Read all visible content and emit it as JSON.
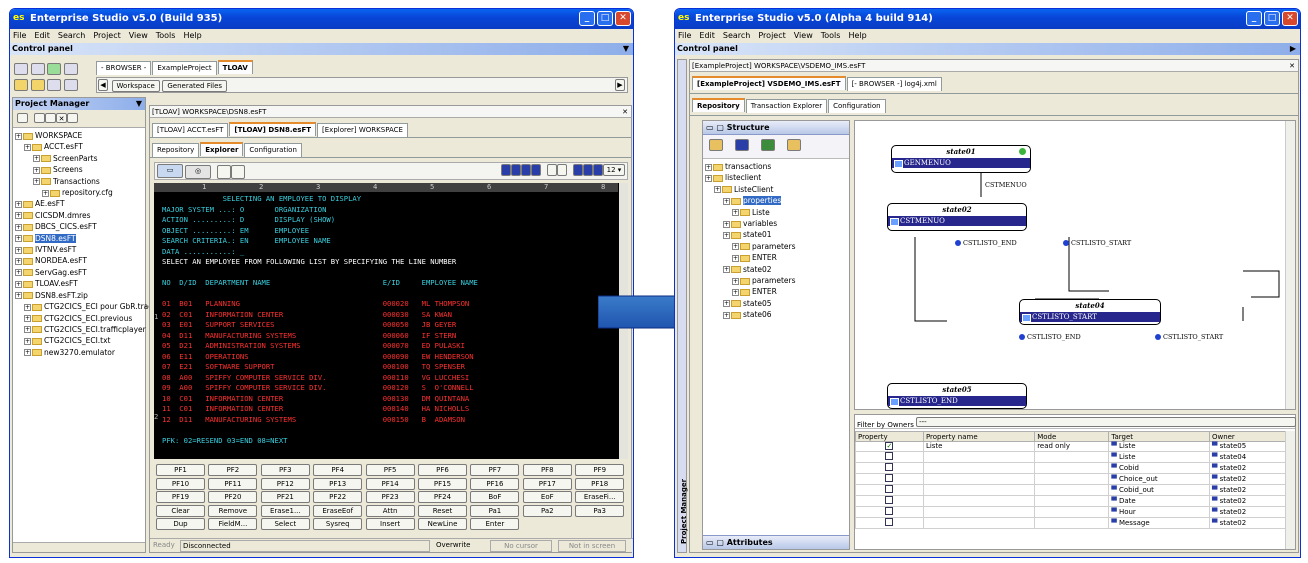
{
  "left": {
    "title": "Enterprise Studio v5.0 (Build 935)",
    "menu": [
      "File",
      "Edit",
      "Search",
      "Project",
      "View",
      "Tools",
      "Help"
    ],
    "control_panel": "Control panel",
    "browser_tabs": [
      "- BROWSER -",
      "ExampleProject",
      "TLOAV"
    ],
    "workspace_btn": "Workspace",
    "generated_btn": "Generated Files",
    "project_manager": "Project Manager",
    "tree": [
      {
        "t": "WORKSPACE",
        "l": 0
      },
      {
        "t": "ACCT.esFT",
        "l": 1
      },
      {
        "t": "ScreenParts",
        "l": 2
      },
      {
        "t": "Screens",
        "l": 2
      },
      {
        "t": "Transactions",
        "l": 2
      },
      {
        "t": "repository.cfg",
        "l": 3
      },
      {
        "t": "AE.esFT",
        "l": 0
      },
      {
        "t": "CICSDM.dmres",
        "l": 0
      },
      {
        "t": "DBCS_CICS.esFT",
        "l": 0
      },
      {
        "t": "DSN8.esFT",
        "l": 0,
        "sel": true
      },
      {
        "t": "IVTNV.esFT",
        "l": 0
      },
      {
        "t": "NORDEA.esFT",
        "l": 0
      },
      {
        "t": "ServGag.esFT",
        "l": 0
      },
      {
        "t": "TLOAV.esFT",
        "l": 0
      },
      {
        "t": "DSN8.esFT.zip",
        "l": 0
      },
      {
        "t": "CTG2CICS_ECI pour GbR.trace",
        "l": 1
      },
      {
        "t": "CTG2CICS_ECI.previous",
        "l": 1
      },
      {
        "t": "CTG2CICS_ECI.trafficplayer",
        "l": 1
      },
      {
        "t": "CTG2CICS_ECI.txt",
        "l": 1
      },
      {
        "t": "new3270.emulator",
        "l": 1
      }
    ],
    "doc_path": "[TLOAV] WORKSPACE\\DSN8.esFT",
    "doc_tabs": [
      "[TLOAV] ACCT.esFT",
      "[TLOAV] DSN8.esFT",
      "[Explorer] WORKSPACE"
    ],
    "view_tabs": [
      "Repository",
      "Explorer",
      "Configuration"
    ],
    "font_size": "12",
    "ruler": [
      "1",
      "2",
      "3",
      "4",
      "5",
      "6",
      "7",
      "8"
    ],
    "screen_lines": [
      {
        "t": "              SELECTING AN EMPLOYEE TO DISPLAY",
        "c": "cyan"
      },
      {
        "t": "MAJOR SYSTEM ...: O       ORGANIZATION",
        "c": "cyan"
      },
      {
        "t": "ACTION .........: D       DISPLAY (SHOW)",
        "c": "cyan"
      },
      {
        "t": "OBJECT .........: EM      EMPLOYEE",
        "c": "cyan"
      },
      {
        "t": "SEARCH CRITERIA.: EN      EMPLOYEE NAME",
        "c": "cyan"
      },
      {
        "t": "DATA ...........: _",
        "c": "cyan"
      },
      {
        "t": "SELECT AN EMPLOYEE FROM FOLLOWING LIST BY SPECIFYING THE LINE NUMBER",
        "c": "wh"
      },
      {
        "t": "",
        "c": "wh"
      },
      {
        "t": "NO  D/ID  DEPARTMENT NAME                          E/ID     EMPLOYEE NAME",
        "c": "cyan"
      },
      {
        "t": "",
        "c": "wh"
      },
      {
        "t": "01  B01   PLANNING                                 000020   ML THOMPSON",
        "c": "red"
      },
      {
        "t": "02  C01   INFORMATION CENTER                       000030   SA KWAN",
        "c": "red"
      },
      {
        "t": "03  E01   SUPPORT SERVICES                         000050   JB GEYER",
        "c": "red"
      },
      {
        "t": "04  D11   MANUFACTURING SYSTEMS                    000060   IF STERN",
        "c": "red"
      },
      {
        "t": "05  D21   ADMINISTRATION SYSTEMS                   000070   ED PULASKI",
        "c": "red"
      },
      {
        "t": "06  E11   OPERATIONS                               000090   EW HENDERSON",
        "c": "red"
      },
      {
        "t": "07  E21   SOFTWARE SUPPORT                         000100   TQ SPENSER",
        "c": "red"
      },
      {
        "t": "08  A00   SPIFFY COMPUTER SERVICE DIV.             000110   VG LUCCHESI",
        "c": "red"
      },
      {
        "t": "09  A00   SPIFFY COMPUTER SERVICE DIV.             000120   S  O'CONNELL",
        "c": "red"
      },
      {
        "t": "10  C01   INFORMATION CENTER                       000130   DM QUINTANA",
        "c": "red"
      },
      {
        "t": "11  C01   INFORMATION CENTER                       000140   HA NICHOLLS",
        "c": "red"
      },
      {
        "t": "12  D11   MANUFACTURING SYSTEMS                    000150   B  ADAMSON",
        "c": "red"
      },
      {
        "t": "",
        "c": "wh"
      },
      {
        "t": "PFK: 02=RESEND 03=END 08=NEXT",
        "c": "cyan"
      }
    ],
    "keys": [
      [
        "PF1",
        "PF2",
        "PF3",
        "PF4",
        "PF5",
        "PF6",
        "PF7",
        "PF8",
        "PF9"
      ],
      [
        "PF10",
        "PF11",
        "PF12",
        "PF13",
        "PF14",
        "PF15",
        "PF16",
        "PF17",
        "PF18"
      ],
      [
        "PF19",
        "PF20",
        "PF21",
        "PF22",
        "PF23",
        "PF24",
        "BoF",
        "EoF",
        "EraseFi..."
      ],
      [
        "Clear",
        "Remove",
        "Erase1...",
        "EraseEof",
        "Attn",
        "Reset",
        "Pa1",
        "Pa2",
        "Pa3"
      ],
      [
        "Dup",
        "FieldM...",
        "Select",
        "Sysreq",
        "Insert",
        "NewLine",
        "Enter"
      ]
    ],
    "status": {
      "ready": "Ready",
      "conn": "Disconnected",
      "mode": "Overwrite",
      "cursor": "No cursor",
      "screen": "Not in screen"
    }
  },
  "right": {
    "title": "Enterprise Studio v5.0 (Alpha 4 build 914)",
    "menu": [
      "File",
      "Edit",
      "Search",
      "Project",
      "View",
      "Tools",
      "Help"
    ],
    "control_panel": "Control panel",
    "doc_path": "[ExampleProject]  WORKSPACE\\VSDEMO_IMS.esFT",
    "doc_tabs": [
      "[ExampleProject] VSDEMO_IMS.esFT",
      "[- BROWSER -] log4j.xml"
    ],
    "view_tabs": [
      "Repository",
      "Transaction Explorer",
      "Configuration"
    ],
    "structure": "Structure",
    "attributes": "Attributes",
    "side_label": "Project Manager",
    "tree": [
      {
        "t": "transactions",
        "l": 0
      },
      {
        "t": "listeclient",
        "l": 0
      },
      {
        "t": "ListeClient",
        "l": 1
      },
      {
        "t": "properties",
        "l": 2,
        "sel": true
      },
      {
        "t": "Liste",
        "l": 3
      },
      {
        "t": "variables",
        "l": 2
      },
      {
        "t": "state01",
        "l": 2
      },
      {
        "t": "parameters",
        "l": 3
      },
      {
        "t": "ENTER",
        "l": 3
      },
      {
        "t": "state02",
        "l": 2
      },
      {
        "t": "parameters",
        "l": 3
      },
      {
        "t": "ENTER",
        "l": 3
      },
      {
        "t": "",
        "l": 3
      },
      {
        "t": "",
        "l": 3
      },
      {
        "t": "",
        "l": 3
      },
      {
        "t": "state05",
        "l": 2
      },
      {
        "t": "state06",
        "l": 2
      }
    ],
    "diagram": {
      "state01": {
        "name": "state01",
        "row": "GENMENUO"
      },
      "state02": {
        "name": "state02",
        "row": "CSTMENUO"
      },
      "state04": {
        "name": "state04",
        "row": "CSTLISTO_START"
      },
      "state05": {
        "name": "state05",
        "row": "CSTLISTO_END"
      },
      "labels": [
        "CSTMENUO",
        "CSTLISTO_END",
        "CSTLISTO_START",
        "CSTLISTO_END",
        "CSTLISTO_START"
      ]
    },
    "filter": {
      "label": "Filter by Owners",
      "value": "---"
    },
    "grid_headers": [
      "Property",
      "Property name",
      "Mode",
      "Target",
      "Owner"
    ],
    "grid_rows": [
      {
        "name": "Liste",
        "mode": "read only",
        "target": "Liste",
        "owner": "state05",
        "checked": true
      },
      {
        "name": "",
        "mode": "",
        "target": "Liste",
        "owner": "state04",
        "checked": false
      },
      {
        "name": "",
        "mode": "",
        "target": "Cobid",
        "owner": "state02",
        "checked": false
      },
      {
        "name": "",
        "mode": "",
        "target": "Choice_out",
        "owner": "state02",
        "checked": false
      },
      {
        "name": "",
        "mode": "",
        "target": "Cobid_out",
        "owner": "state02",
        "checked": false
      },
      {
        "name": "",
        "mode": "",
        "target": "Date",
        "owner": "state02",
        "checked": false
      },
      {
        "name": "",
        "mode": "",
        "target": "Hour",
        "owner": "state02",
        "checked": false
      },
      {
        "name": "",
        "mode": "",
        "target": "Message",
        "owner": "state02",
        "checked": false
      }
    ]
  }
}
